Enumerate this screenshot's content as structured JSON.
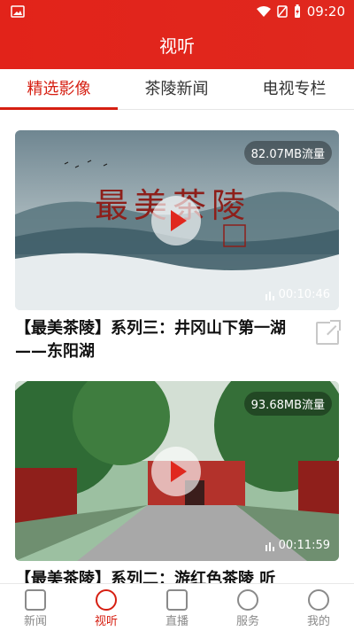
{
  "statusbar": {
    "time": "09:20"
  },
  "header": {
    "title": "视听"
  },
  "tabs": [
    {
      "label": "精选影像"
    },
    {
      "label": "茶陵新闻"
    },
    {
      "label": "电视专栏"
    }
  ],
  "videos": [
    {
      "size": "82.07MB流量",
      "duration": "00:10:46",
      "title": "【最美茶陵】系列三：井冈山下第一湖——东阳湖"
    },
    {
      "size": "93.68MB流量",
      "duration": "00:11:59",
      "title": "【最美茶陵】系列二：游红色茶陵 听"
    }
  ],
  "bottom_nav": [
    {
      "label": "新闻"
    },
    {
      "label": "视听"
    },
    {
      "label": "直播"
    },
    {
      "label": "服务"
    },
    {
      "label": "我的"
    }
  ],
  "colors": {
    "accent": "#e2231a",
    "active_text": "#d61f12"
  },
  "icons": [
    "image-icon",
    "wifi-icon",
    "no-sim-icon",
    "battery-icon",
    "play-icon",
    "share-icon",
    "news-icon",
    "video-icon",
    "live-icon",
    "services-icon",
    "profile-icon"
  ]
}
